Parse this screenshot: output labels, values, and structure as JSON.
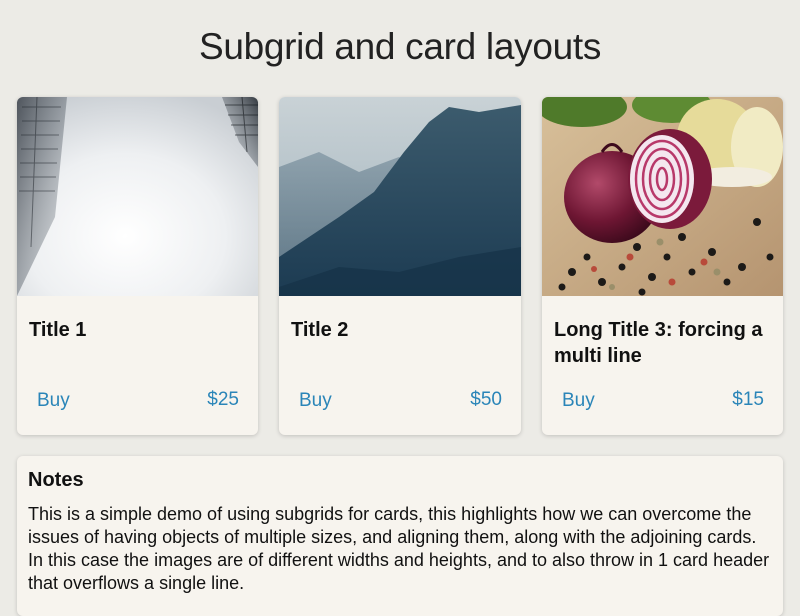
{
  "page": {
    "title": "Subgrid and card layouts"
  },
  "cards": [
    {
      "image": "foggy-skyscrapers-photo",
      "title": "Title 1",
      "buy_label": "Buy",
      "price": "$25"
    },
    {
      "image": "misty-mountain-photo",
      "title": "Title 2",
      "buy_label": "Buy",
      "price": "$50"
    },
    {
      "image": "red-onion-peppercorns-photo",
      "title": "Long Title 3: forcing a multi line",
      "buy_label": "Buy",
      "price": "$15"
    }
  ],
  "notes": {
    "heading": "Notes",
    "body": "This is a simple demo of using subgrids for cards, this highlights how we can overcome the issues of having objects of multiple sizes, and aligning them, along with the adjoining cards. In this case the images are of different widths and heights, and to also throw in 1 card header that overflows a single line."
  },
  "colors": {
    "page_background": "#ecebe6",
    "card_background": "#f7f4ee",
    "link": "#2a85b8"
  }
}
